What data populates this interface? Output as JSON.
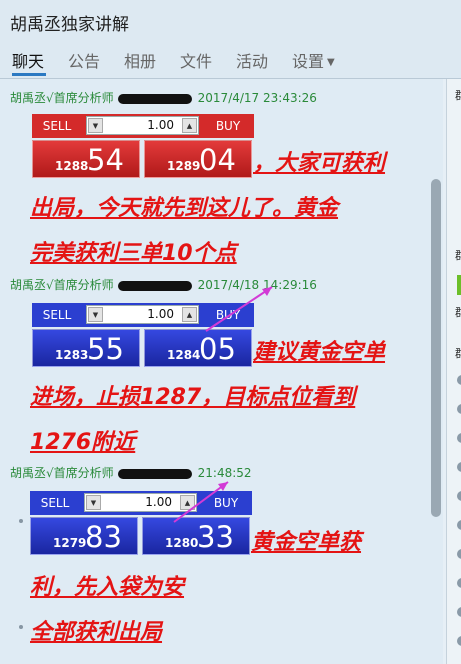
{
  "window": {
    "title": "胡禹丞独家讲解"
  },
  "tabs": [
    {
      "label": "聊天",
      "active": true
    },
    {
      "label": "公告"
    },
    {
      "label": "相册"
    },
    {
      "label": "文件"
    },
    {
      "label": "活动"
    },
    {
      "label": "设置"
    }
  ],
  "messages": [
    {
      "sender": "胡禹丞√首席分析师",
      "time": "2017/4/17 23:43:26",
      "widget": {
        "theme": "red",
        "sell_label": "SELL",
        "buy_label": "BUY",
        "qty": "1.00",
        "sell_prefix": "1288",
        "sell_suffix": "54",
        "buy_prefix": "1289",
        "buy_suffix": "04"
      },
      "lines": [
        "，大家可获利",
        "出局，今天就先到这儿了。黄金",
        "完美获利三单10个点"
      ]
    },
    {
      "sender": "胡禹丞√首席分析师",
      "time": "2017/4/18 14:29:16",
      "widget": {
        "theme": "blue",
        "sell_label": "SELL",
        "buy_label": "BUY",
        "qty": "1.00",
        "sell_prefix": "1283",
        "sell_suffix": "55",
        "buy_prefix": "1284",
        "buy_suffix": "05"
      },
      "lines": [
        "建议黄金空单",
        "进场，止损1287，目标点位看到",
        "1276附近"
      ]
    },
    {
      "sender": "胡禹丞√首席分析师",
      "time": "21:48:52",
      "widget": {
        "theme": "blue",
        "sell_label": "SELL",
        "buy_label": "BUY",
        "qty": "1.00",
        "sell_prefix": "1279",
        "sell_suffix": "83",
        "buy_prefix": "1280",
        "buy_suffix": "33"
      },
      "lines": [
        "黄金空单获",
        "利，先入袋为安",
        "全部获利出局"
      ]
    }
  ],
  "right_panel": {
    "labels": [
      "群",
      "群",
      "群",
      "群"
    ]
  }
}
